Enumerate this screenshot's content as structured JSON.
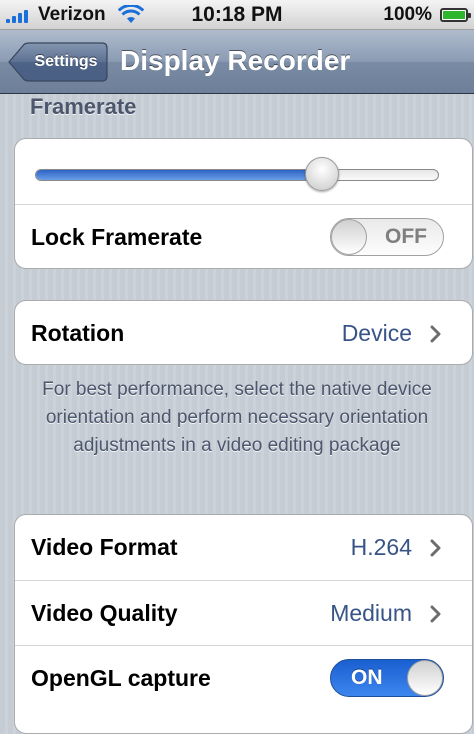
{
  "status_bar": {
    "carrier": "Verizon",
    "time": "10:18 PM",
    "battery_percent": "100%",
    "signal_icon": "signal-bars-icon",
    "wifi_icon": "wifi-icon",
    "battery_icon": "battery-charging-icon"
  },
  "nav": {
    "back_label": "Settings",
    "title": "Display Recorder"
  },
  "framerate": {
    "header": "Framerate",
    "slider_value_fraction": 0.71,
    "lock_label": "Lock Framerate",
    "lock_state": "OFF"
  },
  "rotation": {
    "label": "Rotation",
    "value": "Device",
    "note": "For best performance, select the native device orientation and perform necessary orientation adjustments in a video editing package"
  },
  "video": {
    "format_label": "Video Format",
    "format_value": "H.264",
    "quality_label": "Video Quality",
    "quality_value": "Medium",
    "opengl_label": "OpenGL capture",
    "opengl_state": "ON"
  },
  "colors": {
    "accent_blue": "#2c63c4",
    "value_text": "#385487",
    "background": "#c5ccd4"
  }
}
